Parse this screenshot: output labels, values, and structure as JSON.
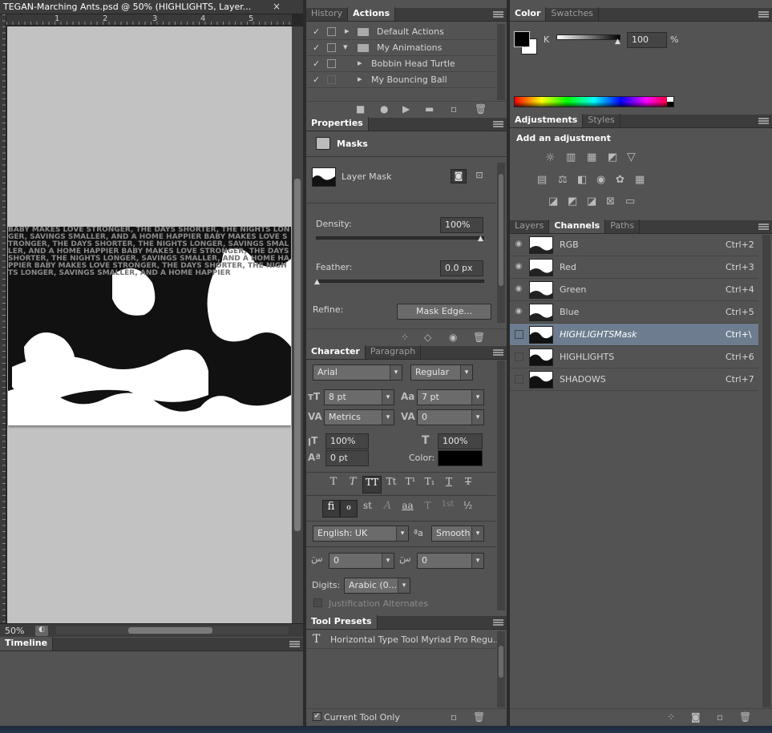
{
  "document": {
    "tab_title": "TEGAN-Marching Ants.psd @ 50% (HIGHLIGHTS, Layer...",
    "zoom": "50%",
    "ruler_marks": [
      "1",
      "2",
      "3",
      "4",
      "5"
    ],
    "canvas_text": "BABY MAKES LOVE STRONGER, THE DAYS SHORTER, THE NIGHTS LONGER, SAVINGS SMALLER, AND A HOME HAPPIER"
  },
  "timeline": {
    "label": "Timeline"
  },
  "history_actions": {
    "tabs": [
      "History",
      "Actions"
    ],
    "items": [
      {
        "label": "Default Actions",
        "type": "folder",
        "expanded": false
      },
      {
        "label": "My Animations",
        "type": "folder",
        "expanded": true
      },
      {
        "label": "Bobbin Head Turtle",
        "type": "action"
      },
      {
        "label": "My Bouncing Ball",
        "type": "action"
      }
    ]
  },
  "properties": {
    "tab": "Properties",
    "section": "Masks",
    "layer_mask_label": "Layer Mask",
    "density_label": "Density:",
    "density_value": "100%",
    "feather_label": "Feather:",
    "feather_value": "0.0 px",
    "refine_label": "Refine:",
    "mask_edge_button": "Mask Edge...",
    "density_fraction": 1.0,
    "feather_fraction": 0.0
  },
  "character": {
    "tabs": [
      "Character",
      "Paragraph"
    ],
    "font_family": "Arial",
    "font_style": "Regular",
    "font_size": "8 pt",
    "leading": "7 pt",
    "kerning": "Metrics",
    "tracking": "0",
    "vertical_scale": "100%",
    "horizontal_scale": "100%",
    "baseline_shift": "0 pt",
    "color_label": "Color:",
    "style_buttons": [
      "T",
      "T",
      "TT",
      "Tt",
      "T¹",
      "T₁",
      "T",
      "T"
    ],
    "opentype_buttons": [
      "fi",
      "ℴ",
      "st",
      "A",
      "aa",
      "T",
      "1st",
      "½"
    ],
    "language": "English: UK",
    "aa_label": "ªa",
    "antialias": "Smooth",
    "diacritic_1": "0",
    "diacritic_2": "0",
    "digits_label": "Digits:",
    "digits_value": "Arabic (0...",
    "justification_label": "Justification Alternates"
  },
  "tool_presets": {
    "tab": "Tool Presets",
    "item": "Horizontal Type Tool Myriad Pro Regu...",
    "current_tool_only": "Current Tool Only"
  },
  "color": {
    "tabs": [
      "Color",
      "Swatches"
    ],
    "channel_label": "K",
    "value": "100",
    "unit": "%"
  },
  "adjustments": {
    "tabs": [
      "Adjustments",
      "Styles"
    ],
    "heading": "Add an adjustment"
  },
  "channels": {
    "tabs": [
      "Layers",
      "Channels",
      "Paths"
    ],
    "rows": [
      {
        "name": "RGB",
        "shortcut": "Ctrl+2",
        "visible": true,
        "selected": false
      },
      {
        "name": "Red",
        "shortcut": "Ctrl+3",
        "visible": true,
        "selected": false
      },
      {
        "name": "Green",
        "shortcut": "Ctrl+4",
        "visible": true,
        "selected": false
      },
      {
        "name": "Blue",
        "shortcut": "Ctrl+5",
        "visible": true,
        "selected": false
      },
      {
        "name": "HIGHLIGHTSMask",
        "shortcut": "Ctrl+\\",
        "visible": false,
        "selected": true
      },
      {
        "name": "HIGHLIGHTS",
        "shortcut": "Ctrl+6",
        "visible": false,
        "selected": false
      },
      {
        "name": "SHADOWS",
        "shortcut": "Ctrl+7",
        "visible": false,
        "selected": false
      }
    ]
  },
  "colors": {
    "panel": "#535353",
    "selected_row": "#6d7d8f",
    "canvas_bg": "#c2c2c2"
  }
}
